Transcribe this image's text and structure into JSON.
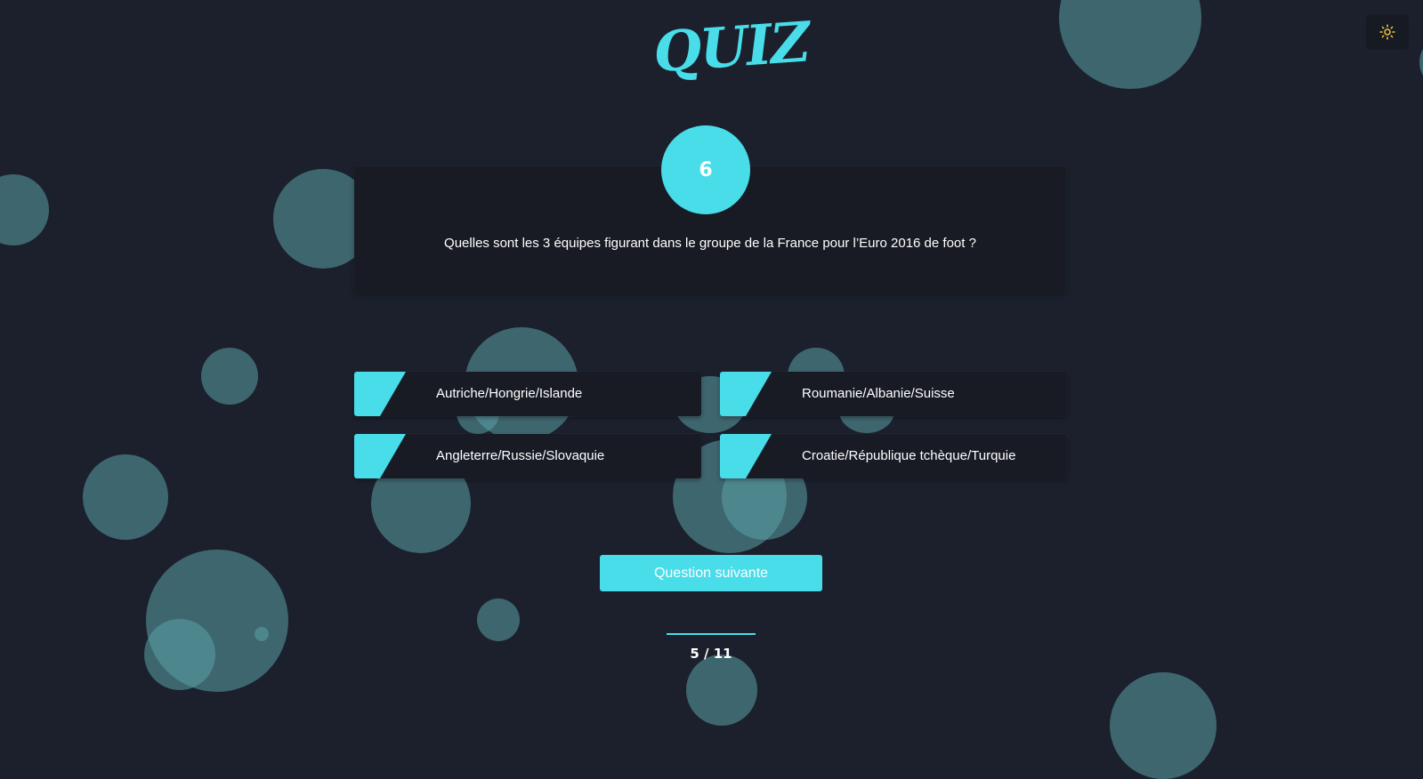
{
  "app": {
    "logo_text": "QUIZ",
    "accent_color": "#48dde9",
    "background_color": "#1b202c",
    "card_color": "#181b24"
  },
  "theme_toggle": {
    "icon": "sun-icon",
    "icon_color": "#f3c33c"
  },
  "question": {
    "number": "6",
    "text": "Quelles sont les 3 équipes figurant dans le groupe de la France pour l’Euro 2016 de foot ?"
  },
  "answers": [
    {
      "label": "Autriche/Hongrie/Islande"
    },
    {
      "label": "Roumanie/Albanie/Suisse"
    },
    {
      "label": "Angleterre/Russie/Slovaquie"
    },
    {
      "label": "Croatie/République tchèque/Turquie"
    }
  ],
  "next_button": {
    "label": "Question suivante"
  },
  "progress": {
    "text": "5 / 11",
    "current": 5,
    "total": 11
  }
}
